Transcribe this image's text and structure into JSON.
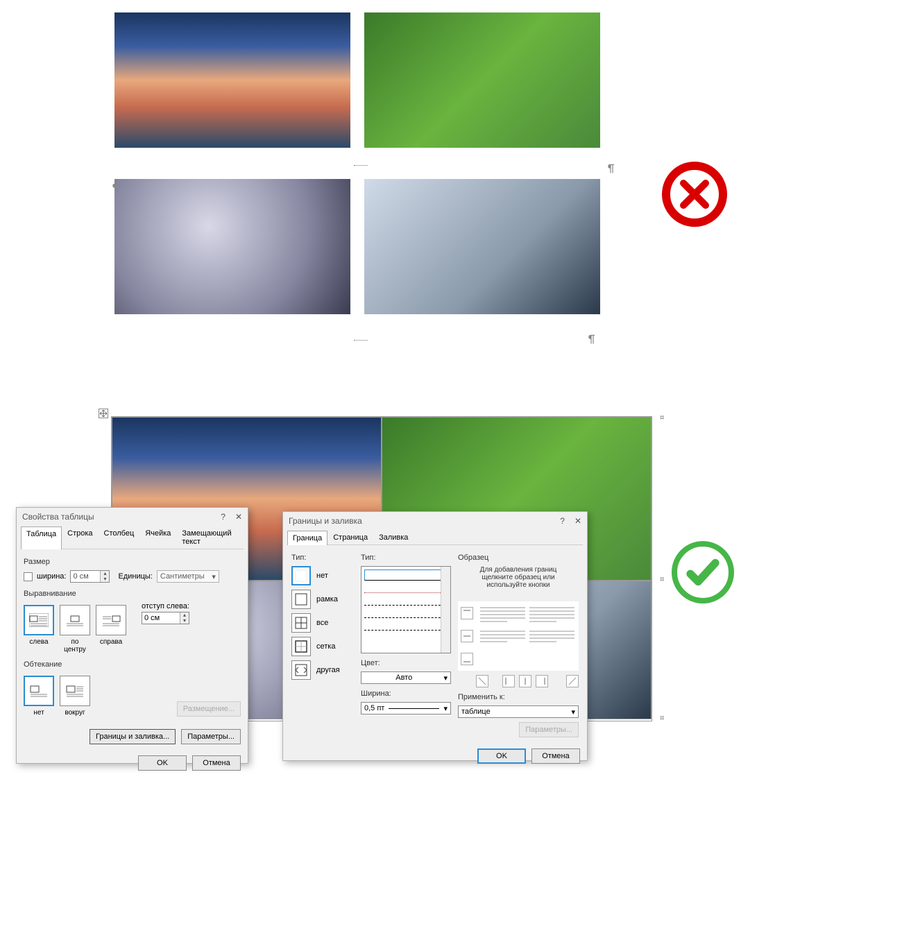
{
  "top": {
    "thumbs": [
      "sunset-lake",
      "butterfly-leaf",
      "electric-guitar",
      "woman-portrait"
    ]
  },
  "dialog1": {
    "title": "Свойства таблицы",
    "tabs": [
      "Таблица",
      "Строка",
      "Столбец",
      "Ячейка",
      "Замещающий текст"
    ],
    "size": {
      "group": "Размер",
      "width_chk": "ширина:",
      "width_val": "0 см",
      "units_lbl": "Единицы:",
      "units_val": "Сантиметры"
    },
    "align": {
      "group": "Выравнивание",
      "labels": [
        "слева",
        "по центру",
        "справа"
      ],
      "indent_lbl": "отступ слева:",
      "indent_val": "0 см"
    },
    "wrap": {
      "group": "Обтекание",
      "labels": [
        "нет",
        "вокруг"
      ],
      "placement_btn": "Размещение..."
    },
    "borders_btn": "Границы и заливка...",
    "options_btn": "Параметры...",
    "ok": "OK",
    "cancel": "Отмена"
  },
  "dialog2": {
    "title": "Границы и заливка",
    "tabs": [
      "Граница",
      "Страница",
      "Заливка"
    ],
    "type_group": "Тип:",
    "settings": [
      "нет",
      "рамка",
      "все",
      "сетка",
      "другая"
    ],
    "style_group": "Тип:",
    "color_lbl": "Цвет:",
    "color_val": "Авто",
    "width_lbl": "Ширина:",
    "width_val": "0,5 пт",
    "preview_group": "Образец",
    "preview_help1": "Для добавления границ",
    "preview_help2": "щелкните образец или",
    "preview_help3": "используйте кнопки",
    "apply_lbl": "Применить к:",
    "apply_val": "таблице",
    "options_btn": "Параметры...",
    "ok": "OK",
    "cancel": "Отмена"
  }
}
